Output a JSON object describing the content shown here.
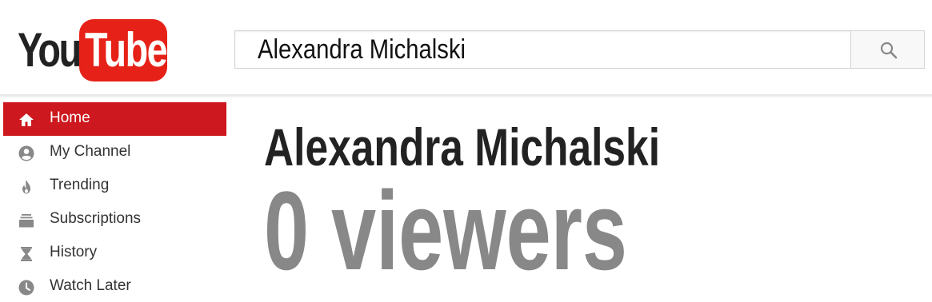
{
  "logo": {
    "you": "You",
    "tube": "Tube"
  },
  "search": {
    "value": "Alexandra Michalski"
  },
  "sidebar": {
    "items": [
      {
        "label": "Home",
        "icon": "home-icon",
        "active": true
      },
      {
        "label": "My Channel",
        "icon": "account-icon",
        "active": false
      },
      {
        "label": "Trending",
        "icon": "flame-icon",
        "active": false
      },
      {
        "label": "Subscriptions",
        "icon": "subscriptions-icon",
        "active": false
      },
      {
        "label": "History",
        "icon": "hourglass-icon",
        "active": false
      },
      {
        "label": "Watch Later",
        "icon": "clock-icon",
        "active": false
      }
    ]
  },
  "main": {
    "channel_name": "Alexandra Michalski",
    "viewers_text": "0 viewers"
  },
  "colors": {
    "brand_red": "#e62117",
    "active_red": "#cc181e",
    "viewers_gray": "#888888"
  }
}
